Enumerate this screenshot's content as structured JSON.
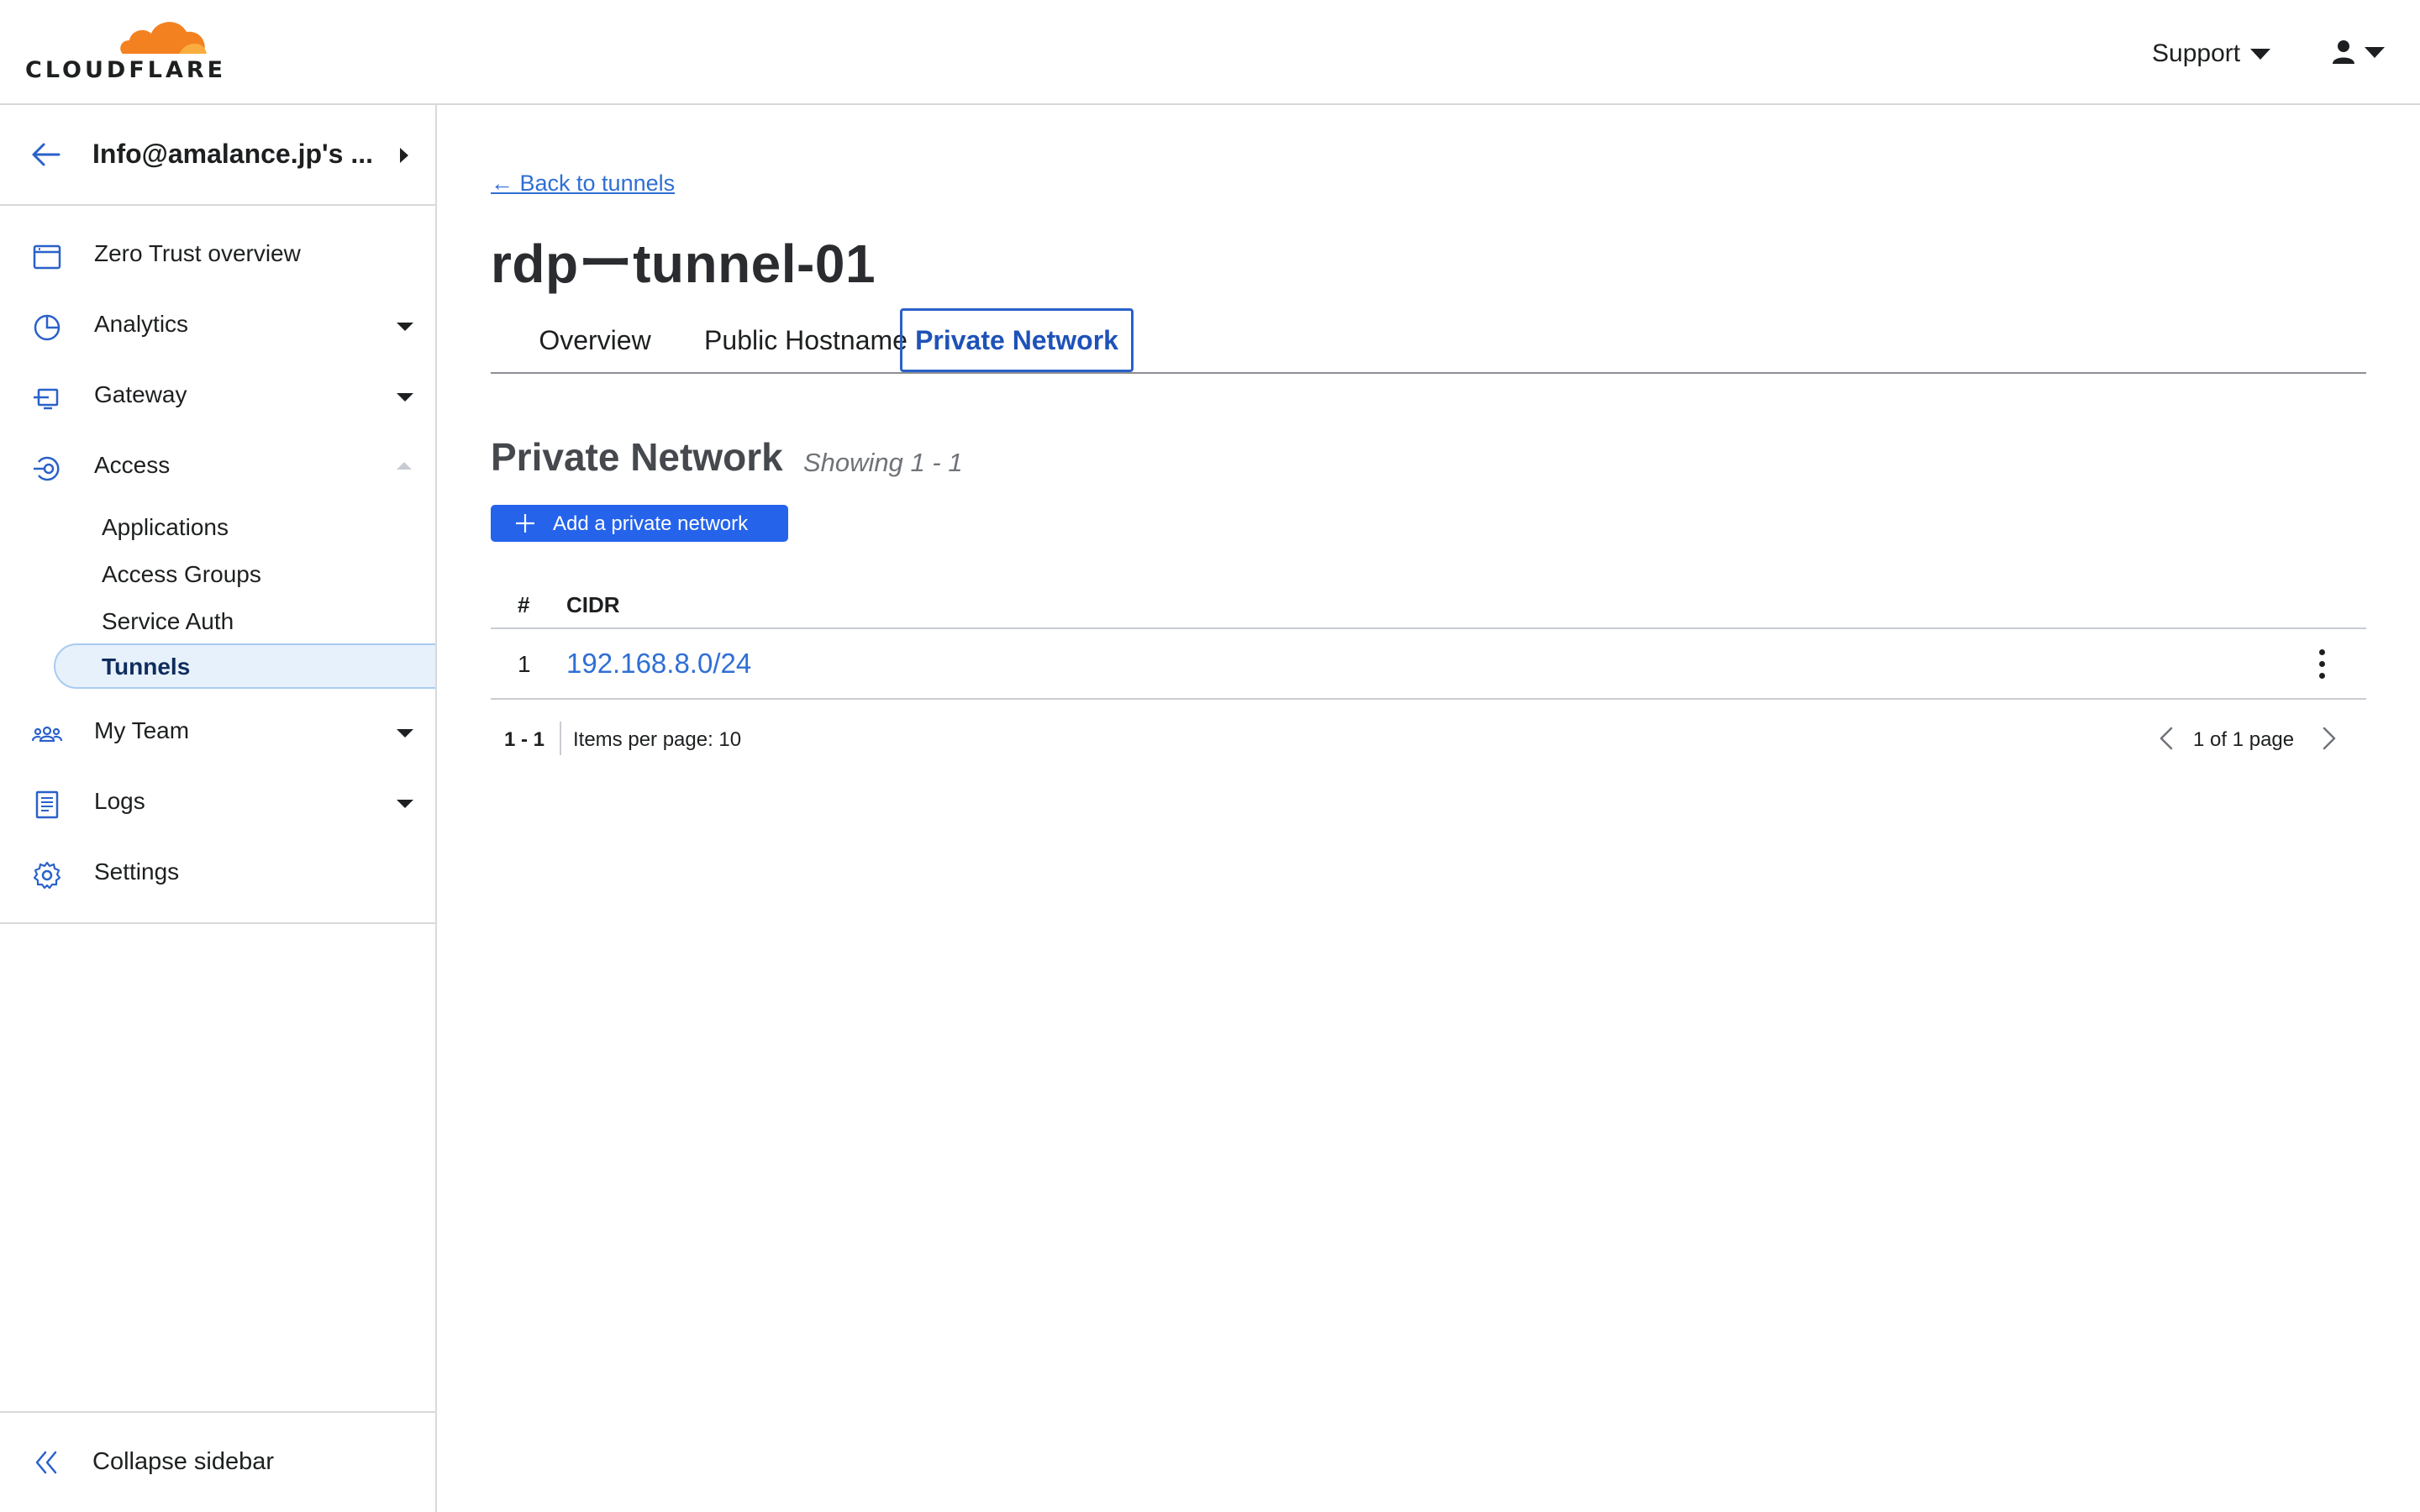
{
  "header": {
    "logo_text": "CLOUDFLARE",
    "support_label": "Support",
    "brand_colors": {
      "orange": "#f48120",
      "light_orange": "#faad3f"
    }
  },
  "sidebar": {
    "account_name": "Info@amalance.jp's ...",
    "nav": [
      {
        "label": "Zero Trust overview",
        "icon": "browser-window-icon"
      },
      {
        "label": "Analytics",
        "icon": "pie-chart-icon",
        "expandable": true
      },
      {
        "label": "Gateway",
        "icon": "gateway-icon",
        "expandable": true
      },
      {
        "label": "Access",
        "icon": "access-icon",
        "expanded": true
      }
    ],
    "access_sub": [
      {
        "label": "Applications"
      },
      {
        "label": "Access Groups"
      },
      {
        "label": "Service Auth"
      },
      {
        "label": "Tunnels",
        "active": true
      }
    ],
    "nav_after": [
      {
        "label": "My Team",
        "icon": "team-icon",
        "expandable": true
      },
      {
        "label": "Logs",
        "icon": "logs-icon",
        "expandable": true
      },
      {
        "label": "Settings",
        "icon": "gear-icon"
      }
    ],
    "collapse_label": "Collapse sidebar"
  },
  "main": {
    "back_link": "← Back to tunnels",
    "title": "rdpーtunnel-01",
    "tabs": [
      {
        "label": "Overview"
      },
      {
        "label": "Public Hostname"
      },
      {
        "label": "Private Network",
        "active": true
      }
    ],
    "section_title": "Private Network",
    "section_meta": "Showing 1 - 1",
    "add_button": "Add a private network",
    "table": {
      "headers": [
        "#",
        "CIDR"
      ],
      "rows": [
        {
          "index": "1",
          "cidr": "192.168.8.0/24"
        }
      ]
    },
    "pagination": {
      "range": "1 - 1",
      "items_per_page": "Items per page: 10",
      "page_info": "1 of 1 page"
    },
    "colors": {
      "accent": "#2563eb",
      "link": "#2f6fd4"
    }
  }
}
